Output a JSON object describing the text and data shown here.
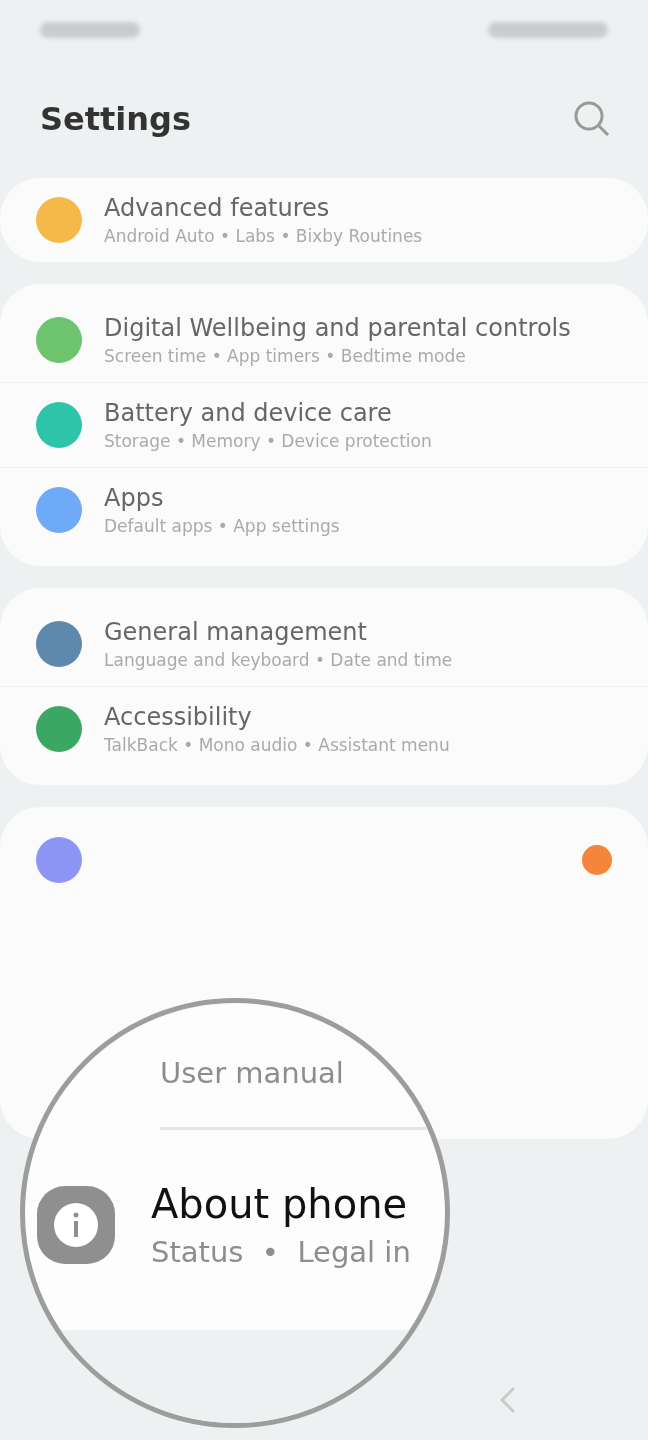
{
  "header": {
    "title": "Settings"
  },
  "groups": [
    {
      "items": [
        {
          "title": "Advanced features",
          "subtitle": "Android Auto • Labs • Bixby Routines",
          "color": "#f5b94a",
          "badge": false
        }
      ]
    },
    {
      "items": [
        {
          "title": "Digital Wellbeing and parental controls",
          "subtitle": "Screen time • App timers • Bedtime mode",
          "color": "#6ec46e",
          "badge": false
        },
        {
          "title": "Battery and device care",
          "subtitle": "Storage • Memory • Device protection",
          "color": "#2ec4a9",
          "badge": false
        },
        {
          "title": "Apps",
          "subtitle": "Default apps • App settings",
          "color": "#6eaaf7",
          "badge": false
        }
      ]
    },
    {
      "items": [
        {
          "title": "General management",
          "subtitle": "Language and keyboard • Date and time",
          "color": "#5f88ad",
          "badge": false
        },
        {
          "title": "Accessibility",
          "subtitle": "TalkBack • Mono audio • Assistant menu",
          "color": "#3aa862",
          "badge": false
        }
      ]
    },
    {
      "items": [
        {
          "color": "#8d95f5",
          "badge": true
        }
      ]
    }
  ],
  "magnifier": {
    "items": [
      {
        "subtitle": "User manual"
      },
      {
        "title": "About phone",
        "subtitle": "Status  •  Legal in"
      }
    ]
  }
}
